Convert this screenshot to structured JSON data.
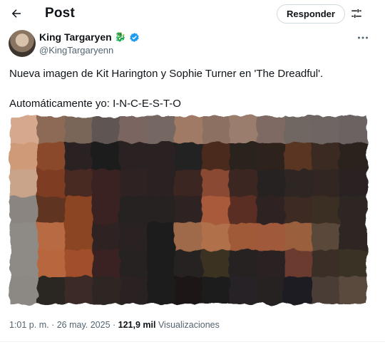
{
  "header": {
    "title": "Post",
    "reply_label": "Responder"
  },
  "author": {
    "display_name": "King Targaryen",
    "handle": "@KingTargaryenn",
    "badge_emoji": "🐉",
    "verified_color": "#1d9bf0"
  },
  "tweet": {
    "line1": "Nueva imagen de Kit Harington y Sophie Turner en 'The Dreadful'.",
    "line2": "Automáticamente yo: I-N-C-E-S-T-O"
  },
  "media": {
    "description_icon": "pixelated-image",
    "pixel_colors": [
      [
        "#d6a98e",
        "#8c6a57",
        "#7a6659",
        "#5e5552",
        "#7a6560",
        "#746863",
        "#a07a65",
        "#8c6f62",
        "#9a7d6c",
        "#7e6a62",
        "#6f6662",
        "#6e6664",
        "#6a6462"
      ],
      [
        "#cf9a78",
        "#8a4a2c",
        "#2b2220",
        "#1f1c1c",
        "#2b2220",
        "#2a2120",
        "#232020",
        "#4a2a1e",
        "#2a201e",
        "#2f231e",
        "#5a3421",
        "#3a2a22",
        "#2a221f"
      ],
      [
        "#c9a48b",
        "#7e3e22",
        "#4a2a22",
        "#3a2320",
        "#2e2220",
        "#2a2120",
        "#3a2520",
        "#8a4a30",
        "#3a2520",
        "#252120",
        "#2f2520",
        "#302520",
        "#2a2420"
      ],
      [
        "#8a8580",
        "#5e3422",
        "#8c4424",
        "#3a2420",
        "#252120",
        "#262220",
        "#2f2320",
        "#a85a3a",
        "#5a2e24",
        "#2f2220",
        "#3e2c22",
        "#3a2e24",
        "#2d2622"
      ],
      [
        "#8e8a86",
        "#b86a42",
        "#8c4424",
        "#2f2220",
        "#2a2120",
        "#1f1d1d",
        "#9e6a48",
        "#b07048",
        "#a05a38",
        "#a05a3a",
        "#9a5e3e",
        "#5a4a3a",
        "#2d2622"
      ],
      [
        "#8e8a86",
        "#b8663e",
        "#a0502a",
        "#3a2420",
        "#252120",
        "#1c1a1a",
        "#252220",
        "#3a3024",
        "#252220",
        "#2a2220",
        "#6a3a2e",
        "#3a2e26",
        "#3a3028"
      ],
      [
        "#8c8884",
        "#2a2624",
        "#3a2c26",
        "#2e2622",
        "#2a2420",
        "#1e1c1c",
        "#1a1818",
        "#1e1e1e",
        "#252425",
        "#262224",
        "#1e1e20",
        "#4a3e34",
        "#5a4a3c"
      ]
    ]
  },
  "meta": {
    "time": "1:01 p. m.",
    "separator": " · ",
    "date": "26 may. 2025",
    "views_count": "121,9 mil",
    "views_label": " Visualizaciones"
  }
}
